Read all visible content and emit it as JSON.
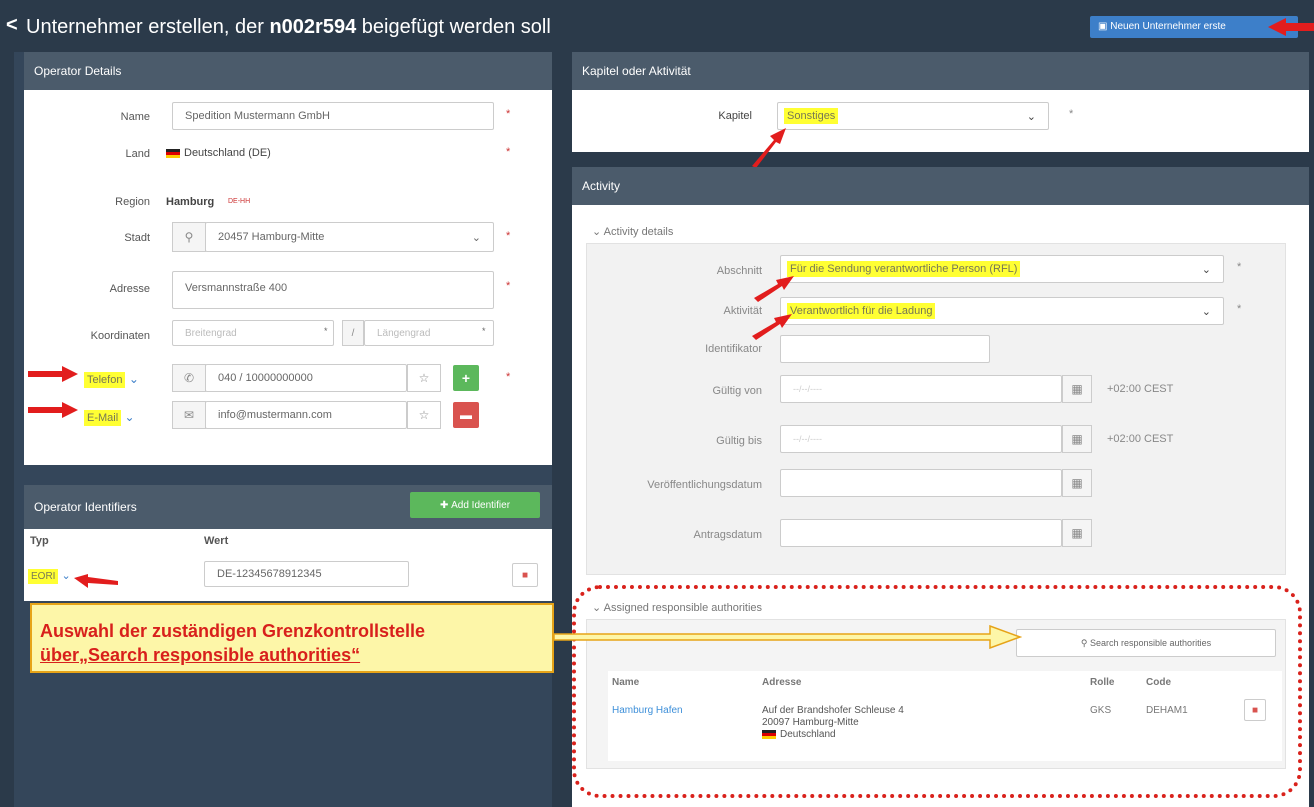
{
  "header": {
    "title_prefix": "Unternehmer erstellen, der ",
    "title_bold": "n002r594",
    "title_suffix": " beigefügt werden soll",
    "create_button": "Neuen Unternehmer erste"
  },
  "operator_details": {
    "heading": "Operator Details",
    "name_label": "Name",
    "name_value": "Spedition Mustermann GmbH",
    "land_label": "Land",
    "land_value": "Deutschland (DE)",
    "region_label": "Region",
    "region_value": "Hamburg",
    "region_code": "DE-HH",
    "stadt_label": "Stadt",
    "stadt_value": "20457 Hamburg-Mitte",
    "adresse_label": "Adresse",
    "adresse_value": "Versmannstraße 400",
    "koordinaten_label": "Koordinaten",
    "lat_placeholder": "Breitengrad",
    "lon_placeholder": "Längengrad",
    "telefon_label": "Telefon",
    "telefon_value": "040 / 10000000000",
    "email_label": "E-Mail",
    "email_value": "info@mustermann.com"
  },
  "operator_identifiers": {
    "heading": "Operator Identifiers",
    "add_button": "Add Identifier",
    "col_typ": "Typ",
    "col_wert": "Wert",
    "typ_value": "EORI",
    "wert_value": "DE-12345678912345"
  },
  "kapitel": {
    "heading": "Kapitel oder Aktivität",
    "label": "Kapitel",
    "value": "Sonstiges"
  },
  "activity": {
    "heading": "Activity",
    "details_title": "Activity details",
    "abschnitt_label": "Abschnitt",
    "abschnitt_value": "Für die Sendung verantwortliche Person (RFL)",
    "aktivitaet_label": "Aktivität",
    "aktivitaet_value": "Verantwortlich für die Ladung",
    "identifikator_label": "Identifikator",
    "gueltig_von_label": "Gültig von",
    "gueltig_bis_label": "Gültig bis",
    "date_placeholder": "--/--/----",
    "timezone": "+02:00 CEST",
    "veroeffentlichung_label": "Veröffentlichungsdatum",
    "antrag_label": "Antragsdatum"
  },
  "authorities": {
    "title": "Assigned responsible authorities",
    "search_button": "Search responsible authorities",
    "col_name": "Name",
    "col_adresse": "Adresse",
    "col_rolle": "Rolle",
    "col_code": "Code",
    "row_name": "Hamburg Hafen",
    "row_address_line1": "Auf der Brandshofer Schleuse 4",
    "row_address_line2": "20097 Hamburg-Mitte",
    "row_country": "Deutschland",
    "row_rolle": "GKS",
    "row_code": "DEHAM1"
  },
  "callout": {
    "line1": "Auswahl der zuständigen Grenzkontrollstelle",
    "line2": "über„Search responsible authorities“"
  }
}
